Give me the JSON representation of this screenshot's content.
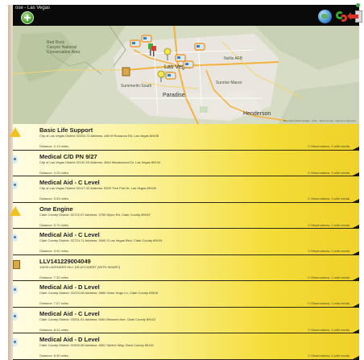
{
  "app": {
    "title": "ose - Las Vegas"
  },
  "toolbar": {
    "add_icon": "plus-circle-icon",
    "globe_icon": "globe-icon",
    "refresh_icon": "refresh-arrows-icon",
    "exit_icon": "exit-door-icon"
  },
  "map": {
    "labels": {
      "red_rock": "Red Rock\nCanyon National\nConservation Area",
      "summerlin": "Summerlin South",
      "las_vegas": "Las Vegas",
      "paradise": "Paradise",
      "henderson": "Henderson",
      "sunrise": "Sunrise Manor",
      "nellis": "Nellis AFB"
    },
    "credit": "Map data ©2013 Google · 5 km · Terms of Use · Report a map error"
  },
  "incidents": [
    {
      "title": "Basic Life Support",
      "address": "City of Las Vegas District 02325-73 Address: 480 W Bonanza Rd, Las Vegas 89106",
      "distance": "Distance: 2.13 miles",
      "observations": "0 Observations, 0 with media",
      "icon": "warning-triangle-icon"
    },
    {
      "title": "Medical C/D PN 9/27",
      "address": "City of Las Vegas District 02110-03 Address: 3844 Meadowood Dr, Las Vegas 89134",
      "distance": "Distance: 4.25 miles",
      "observations": "0 Observations, 0 with media",
      "icon": "medical-icon"
    },
    {
      "title": "Medical Aid - C Level",
      "address": "City of Las Vegas District 02117-32 Address: 5325 Tree Port Dr, Las Vegas 89128",
      "distance": "Distance: 3.93 miles",
      "observations": "0 Observations, 0 with media",
      "icon": "medical-icon"
    },
    {
      "title": "One Engine",
      "address": "Clark County District: 02722-07 Address: 3750 Wynn Rd, Clark County 89103",
      "distance": "Distance: 5.70 miles",
      "observations": "0 Observations, 0 with media",
      "icon": "warning-triangle-icon"
    },
    {
      "title": "Medical Aid - C Level",
      "address": "Clark County District: 02724-71 Address: 3590 S Las Vegas Blvd, Clark County 89109",
      "distance": "Distance: 5.92 miles",
      "observations": "0 Observations, 0 with media",
      "icon": "medical-icon"
    },
    {
      "title": "LLV141229004049",
      "address": "11635 LAVENDER HILL DR ACCIDENT (WITH INJURY)",
      "distance": "Distance: 7.32 miles",
      "observations": "0 Observations, 0 with media",
      "icon": "package-box-icon"
    },
    {
      "title": "Medical Aid - D Level",
      "address": "Clark County District: 02229-58 Address: 3684 Victor Hugo Ln, Clark County 89115",
      "distance": "Distance: 7.67 miles",
      "observations": "0 Observations, 0 with media",
      "icon": "medical-icon"
    },
    {
      "title": "Medical Aid - C Level",
      "address": "Clark County District: 02531-51 Address: 5061 Blossom Ave, Clark County 89142",
      "distance": "Distance: 8.41 miles",
      "observations": "0 Observations, 0 with media",
      "icon": "medical-icon"
    },
    {
      "title": "Medical Aid - D Level",
      "address": "Clark County District: 01925-58 Address: 4801 Sphinx Way, Clark County 89115",
      "distance": "Distance: 8.90 miles",
      "observations": "0 Observations, 0 with media",
      "icon": "medical-icon"
    }
  ]
}
